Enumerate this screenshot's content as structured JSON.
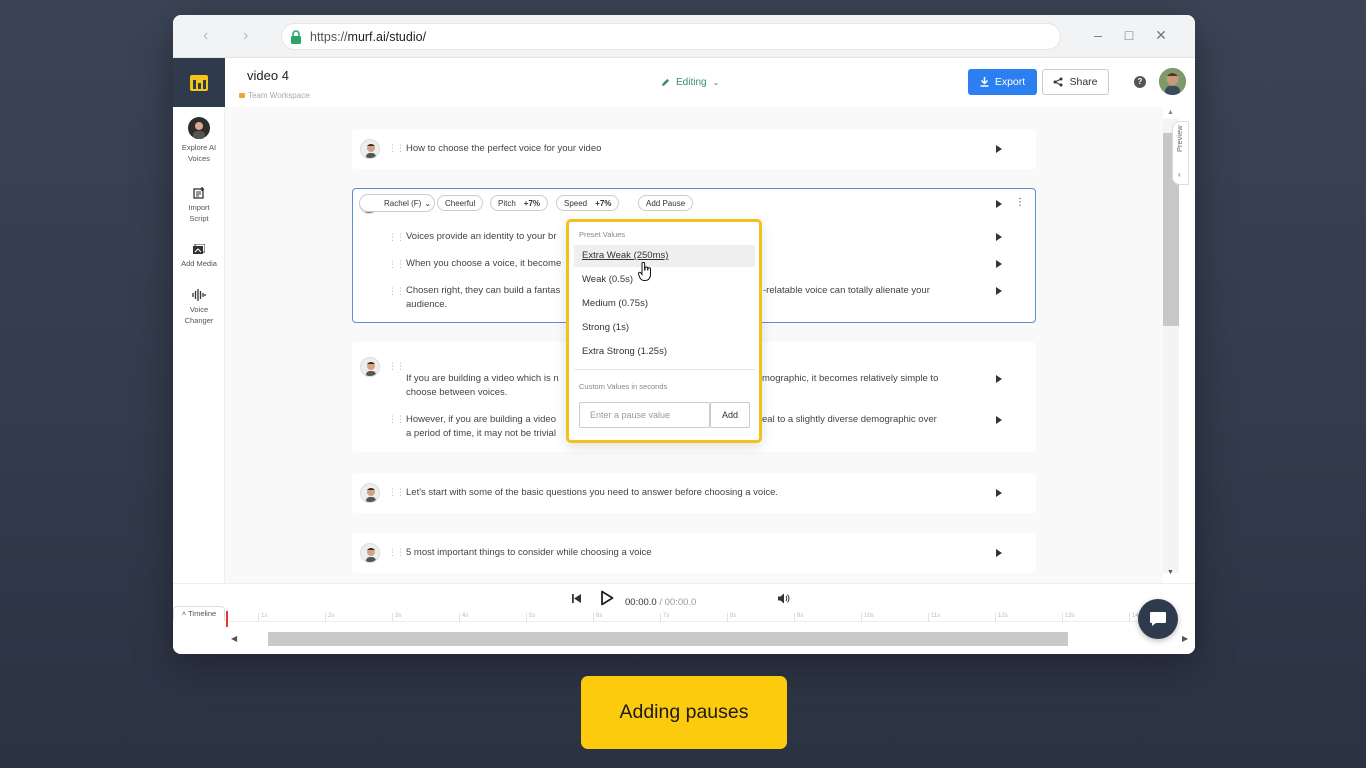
{
  "browser": {
    "url_scheme": "https://",
    "url_host": "murf.ai",
    "url_path": "/studio/"
  },
  "header": {
    "project_title": "video 4",
    "workspace": "Team Workspace",
    "status": "Editing",
    "export_label": "Export",
    "share_label": "Share",
    "help_label": "?"
  },
  "sidebar": {
    "items": [
      {
        "label": "Explore AI Voices",
        "icon": "voice-avatar-icon"
      },
      {
        "label": "Import Script",
        "icon": "import-script-icon"
      },
      {
        "label": "Add Media",
        "icon": "add-media-icon"
      },
      {
        "label": "Voice Changer",
        "icon": "voice-changer-icon"
      }
    ]
  },
  "blocks": [
    {
      "lines": [
        "How to choose the perfect voice for your video"
      ]
    },
    {
      "voice": "Rachel (F)",
      "style": "Cheerful",
      "pitch_label": "Pitch",
      "pitch_value": "+7%",
      "speed_label": "Speed",
      "speed_value": "+7%",
      "add_pause": "Add Pause",
      "lines": [
        "Voices provide an identity to your br",
        "When you choose a voice, it become",
        "Chosen right, they can build a fantas",
        "audience.",
        "-relatable voice can totally alienate your"
      ]
    },
    {
      "lines": [
        "If you are building a video which is n",
        "choose between voices.",
        "mographic, it becomes relatively simple to",
        "However, if you are building a video",
        "a period of time, it may not be trivial",
        "eal to a slightly diverse demographic over"
      ]
    },
    {
      "lines": [
        "Let's start with some of the basic questions you need to answer before choosing a voice."
      ]
    },
    {
      "lines": [
        "5 most important things to consider while choosing a voice"
      ]
    }
  ],
  "pause_menu": {
    "preset_heading": "Preset Values",
    "presets": [
      "Extra Weak (250ms)",
      "Weak (0.5s)",
      "Medium (0.75s)",
      "Strong (1s)",
      "Extra Strong (1.25s)"
    ],
    "hovered_index": 0,
    "custom_heading": "Custom Values in seconds",
    "input_placeholder": "Enter a pause value",
    "add_label": "Add"
  },
  "preview_label": "Preview",
  "player": {
    "current_time": "00:00.0",
    "separator": "/",
    "total_time": "00:00.0",
    "timeline_label": "Timeline",
    "ruler_ticks": [
      "1s",
      "2s",
      "3s",
      "4s",
      "5s",
      "6s",
      "7s",
      "8s",
      "9s",
      "10s",
      "11s",
      "12s",
      "13s",
      "14s"
    ]
  },
  "caption": "Adding pauses",
  "colors": {
    "accent": "#2b7ff0",
    "highlight": "#f4c020",
    "caption_bg": "#fccb0e",
    "logo_bg": "#2f3a4c"
  }
}
